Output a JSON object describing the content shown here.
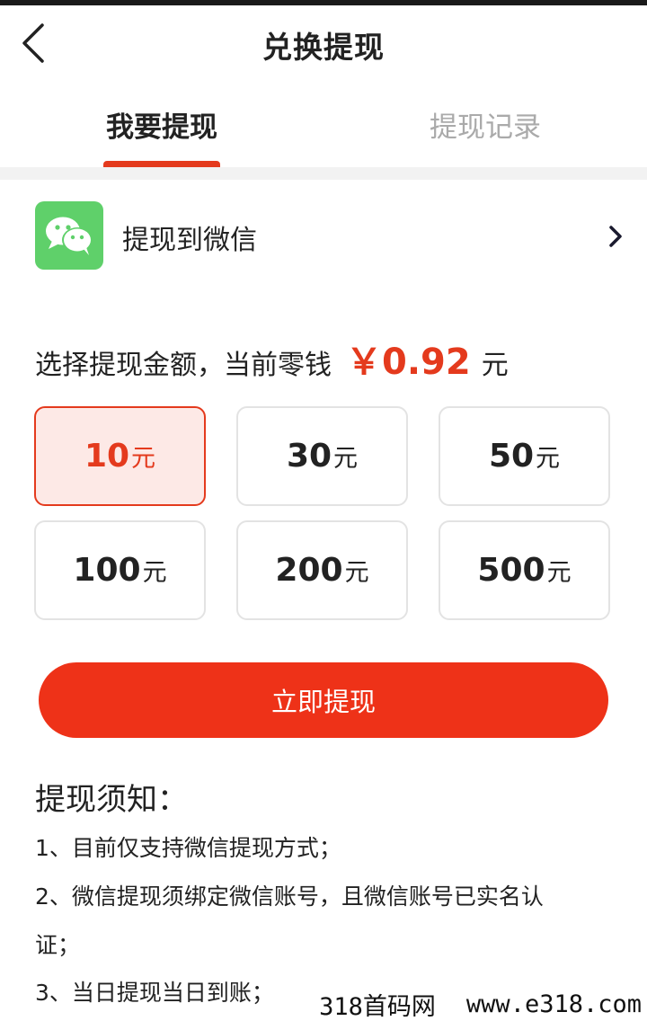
{
  "header": {
    "title": "兑换提现"
  },
  "tabs": [
    {
      "label": "我要提现",
      "active": true
    },
    {
      "label": "提现记录",
      "active": false
    }
  ],
  "method": {
    "label": "提现到微信",
    "icon": "wechat-logo",
    "arrow_icon": "chevron-right-icon"
  },
  "balance": {
    "prefix": "选择提现金额，当前零钱",
    "amount": "￥0.92",
    "unit": "元"
  },
  "amounts": [
    {
      "value": "10",
      "unit": "元",
      "selected": true
    },
    {
      "value": "30",
      "unit": "元",
      "selected": false
    },
    {
      "value": "50",
      "unit": "元",
      "selected": false
    },
    {
      "value": "100",
      "unit": "元",
      "selected": false
    },
    {
      "value": "200",
      "unit": "元",
      "selected": false
    },
    {
      "value": "500",
      "unit": "元",
      "selected": false
    }
  ],
  "withdraw_button": "立即提现",
  "notice": {
    "title": "提现须知：",
    "items": [
      "1、目前仅支持微信提现方式；",
      "2、微信提现须绑定微信账号，且微信账号已实名认",
      "证；",
      "3、当日提现当日到账；"
    ]
  },
  "watermark": {
    "left": "318首码网",
    "right": "www.e318.com"
  },
  "colors": {
    "accent": "#e43a1d",
    "button": "#ee3218",
    "selected_bg": "#fde9e6",
    "wechat_green": "#5fd06a",
    "inactive_tab": "#aaaaaa"
  }
}
